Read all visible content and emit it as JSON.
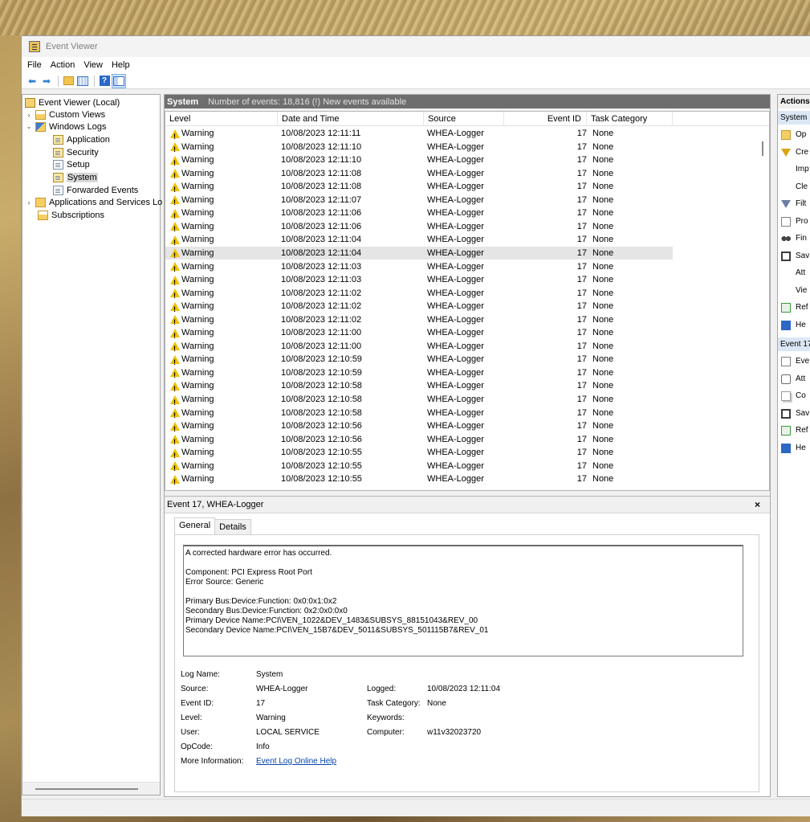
{
  "window": {
    "title": "Event Viewer"
  },
  "menu": [
    "File",
    "Action",
    "View",
    "Help"
  ],
  "toolbar": {
    "icons": [
      "back-arrow-icon",
      "forward-arrow-icon",
      "up-folder-icon",
      "show-hide-console-tree-icon",
      "help-icon",
      "show-hide-action-pane-icon"
    ]
  },
  "tree": {
    "items": [
      {
        "label": "Event Viewer (Local)",
        "toggle": "",
        "icon": "event-viewer-icon"
      },
      {
        "label": "Custom Views",
        "toggle": "›",
        "icon": "folder-icon"
      },
      {
        "label": "Windows Logs",
        "toggle": "⌄",
        "icon": "windows-logs-icon"
      },
      {
        "label": "Application",
        "toggle": "",
        "icon": "log-icon"
      },
      {
        "label": "Security",
        "toggle": "",
        "icon": "log-icon"
      },
      {
        "label": "Setup",
        "toggle": "",
        "icon": "log-icon"
      },
      {
        "label": "System",
        "toggle": "",
        "icon": "log-icon"
      },
      {
        "label": "Forwarded Events",
        "toggle": "",
        "icon": "log-icon"
      },
      {
        "label": "Applications and Services Lo",
        "toggle": "›",
        "icon": "folder-icon"
      },
      {
        "label": "Subscriptions",
        "toggle": "",
        "icon": "subscriptions-icon"
      }
    ]
  },
  "log_header": {
    "name": "System",
    "info": "Number of events: 18,816 (!) New events available"
  },
  "columns": [
    "Level",
    "Date and Time",
    "Source",
    "Event ID",
    "Task Category"
  ],
  "events": [
    {
      "level": "Warning",
      "date": "10/08/2023 12:11:11",
      "source": "WHEA-Logger",
      "id": "17",
      "task": "None"
    },
    {
      "level": "Warning",
      "date": "10/08/2023 12:11:10",
      "source": "WHEA-Logger",
      "id": "17",
      "task": "None"
    },
    {
      "level": "Warning",
      "date": "10/08/2023 12:11:10",
      "source": "WHEA-Logger",
      "id": "17",
      "task": "None"
    },
    {
      "level": "Warning",
      "date": "10/08/2023 12:11:08",
      "source": "WHEA-Logger",
      "id": "17",
      "task": "None"
    },
    {
      "level": "Warning",
      "date": "10/08/2023 12:11:08",
      "source": "WHEA-Logger",
      "id": "17",
      "task": "None"
    },
    {
      "level": "Warning",
      "date": "10/08/2023 12:11:07",
      "source": "WHEA-Logger",
      "id": "17",
      "task": "None"
    },
    {
      "level": "Warning",
      "date": "10/08/2023 12:11:06",
      "source": "WHEA-Logger",
      "id": "17",
      "task": "None"
    },
    {
      "level": "Warning",
      "date": "10/08/2023 12:11:06",
      "source": "WHEA-Logger",
      "id": "17",
      "task": "None"
    },
    {
      "level": "Warning",
      "date": "10/08/2023 12:11:04",
      "source": "WHEA-Logger",
      "id": "17",
      "task": "None"
    },
    {
      "level": "Warning",
      "date": "10/08/2023 12:11:04",
      "source": "WHEA-Logger",
      "id": "17",
      "task": "None"
    },
    {
      "level": "Warning",
      "date": "10/08/2023 12:11:03",
      "source": "WHEA-Logger",
      "id": "17",
      "task": "None"
    },
    {
      "level": "Warning",
      "date": "10/08/2023 12:11:03",
      "source": "WHEA-Logger",
      "id": "17",
      "task": "None"
    },
    {
      "level": "Warning",
      "date": "10/08/2023 12:11:02",
      "source": "WHEA-Logger",
      "id": "17",
      "task": "None"
    },
    {
      "level": "Warning",
      "date": "10/08/2023 12:11:02",
      "source": "WHEA-Logger",
      "id": "17",
      "task": "None"
    },
    {
      "level": "Warning",
      "date": "10/08/2023 12:11:02",
      "source": "WHEA-Logger",
      "id": "17",
      "task": "None"
    },
    {
      "level": "Warning",
      "date": "10/08/2023 12:11:00",
      "source": "WHEA-Logger",
      "id": "17",
      "task": "None"
    },
    {
      "level": "Warning",
      "date": "10/08/2023 12:11:00",
      "source": "WHEA-Logger",
      "id": "17",
      "task": "None"
    },
    {
      "level": "Warning",
      "date": "10/08/2023 12:10:59",
      "source": "WHEA-Logger",
      "id": "17",
      "task": "None"
    },
    {
      "level": "Warning",
      "date": "10/08/2023 12:10:59",
      "source": "WHEA-Logger",
      "id": "17",
      "task": "None"
    },
    {
      "level": "Warning",
      "date": "10/08/2023 12:10:58",
      "source": "WHEA-Logger",
      "id": "17",
      "task": "None"
    },
    {
      "level": "Warning",
      "date": "10/08/2023 12:10:58",
      "source": "WHEA-Logger",
      "id": "17",
      "task": "None"
    },
    {
      "level": "Warning",
      "date": "10/08/2023 12:10:58",
      "source": "WHEA-Logger",
      "id": "17",
      "task": "None"
    },
    {
      "level": "Warning",
      "date": "10/08/2023 12:10:56",
      "source": "WHEA-Logger",
      "id": "17",
      "task": "None"
    },
    {
      "level": "Warning",
      "date": "10/08/2023 12:10:56",
      "source": "WHEA-Logger",
      "id": "17",
      "task": "None"
    },
    {
      "level": "Warning",
      "date": "10/08/2023 12:10:55",
      "source": "WHEA-Logger",
      "id": "17",
      "task": "None"
    },
    {
      "level": "Warning",
      "date": "10/08/2023 12:10:55",
      "source": "WHEA-Logger",
      "id": "17",
      "task": "None"
    },
    {
      "level": "Warning",
      "date": "10/08/2023 12:10:55",
      "source": "WHEA-Logger",
      "id": "17",
      "task": "None"
    }
  ],
  "selected_event_index": 9,
  "detail": {
    "title": "Event 17, WHEA-Logger",
    "close": "×",
    "tabs": [
      "General",
      "Details"
    ],
    "description": [
      "A corrected hardware error has occurred.",
      "",
      "Component: PCI Express Root Port",
      "Error Source: Generic",
      "",
      "Primary Bus:Device:Function: 0x0:0x1:0x2",
      "Secondary Bus:Device:Function: 0x2:0x0:0x0",
      "Primary Device Name:PCI\\VEN_1022&DEV_1483&SUBSYS_88151043&REV_00",
      "Secondary Device Name:PCI\\VEN_15B7&DEV_5011&SUBSYS_501115B7&REV_01"
    ],
    "log_name_label": "Log Name:",
    "log_name": "System",
    "source_label": "Source:",
    "source": "WHEA-Logger",
    "logged_label": "Logged:",
    "logged": "10/08/2023 12:11:04",
    "event_id_label": "Event ID:",
    "event_id": "17",
    "task_category_label": "Task Category:",
    "task_category": "None",
    "level_label": "Level:",
    "level": "Warning",
    "keywords_label": "Keywords:",
    "keywords": "",
    "user_label": "User:",
    "user": "LOCAL SERVICE",
    "computer_label": "Computer:",
    "computer": "w11v32023720",
    "opcode_label": "OpCode:",
    "opcode": "Info",
    "more_info_label": "More Information:",
    "more_info_link": "Event Log Online Help"
  },
  "actions": {
    "title": "Actions",
    "section1": "System",
    "section1_items": [
      {
        "label": "Op",
        "icon": "open-saved-log-icon"
      },
      {
        "label": "Cre",
        "icon": "create-custom-view-icon"
      },
      {
        "label": "Imp",
        "icon": ""
      },
      {
        "label": "Cle",
        "icon": ""
      },
      {
        "label": "Filt",
        "icon": "filter-icon"
      },
      {
        "label": "Pro",
        "icon": "properties-icon"
      },
      {
        "label": "Fin",
        "icon": "find-icon"
      },
      {
        "label": "Sav",
        "icon": "save-icon"
      },
      {
        "label": "Att",
        "icon": ""
      },
      {
        "label": "Vie",
        "icon": ""
      },
      {
        "label": "Ref",
        "icon": "refresh-icon"
      },
      {
        "label": "He",
        "icon": "help-icon"
      }
    ],
    "section2": "Event 17",
    "section2_items": [
      {
        "label": "Eve",
        "icon": "event-properties-icon"
      },
      {
        "label": "Att",
        "icon": "attach-task-icon"
      },
      {
        "label": "Co",
        "icon": "copy-icon"
      },
      {
        "label": "Sav",
        "icon": "save-icon"
      },
      {
        "label": "Ref",
        "icon": "refresh-icon"
      },
      {
        "label": "He",
        "icon": "help-icon"
      }
    ]
  }
}
